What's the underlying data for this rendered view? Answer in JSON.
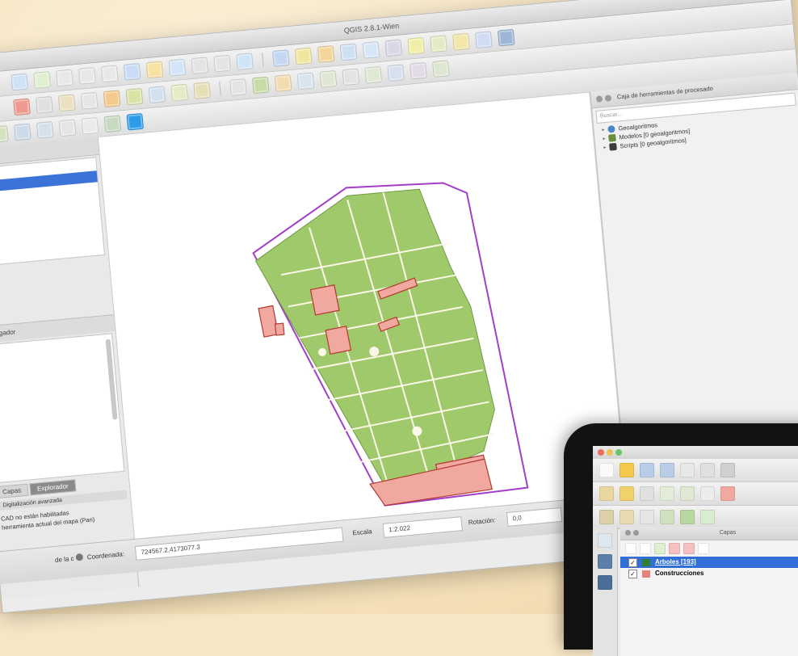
{
  "window": {
    "title": "QGIS 2.8.1-Wien"
  },
  "processing_toolbox": {
    "title": "Caja de herramientas de procesado",
    "search_placeholder": "Buscar...",
    "items": [
      {
        "label": "Geoalgoritmos",
        "icon": "gear-icon"
      },
      {
        "label": "Modelos [0 geoalgoritmos]",
        "icon": "model-icon"
      },
      {
        "label": "Scripts [0 geoalgoritmos]",
        "icon": "script-icon"
      }
    ]
  },
  "left_panel": {
    "browser_title": "Navegador",
    "tabs": [
      "Capas",
      "Explorador"
    ],
    "advanced_section": "Digitalización avanzada",
    "message_line1": "CAD no están habilitadas",
    "message_line2": "herramienta actual del mapa (Pan)"
  },
  "status": {
    "coord_toggle_label": "de la c",
    "coord_label": "Coordenada:",
    "coord_value": "724567.2,4173077.3",
    "scale_label": "Escala",
    "scale_value": "1:2.022",
    "rotation_label": "Rotación:",
    "rotation_value": "0,0"
  },
  "tablet": {
    "layers_title": "Capas",
    "layers": [
      {
        "label": "Arboles [193]",
        "selected": true,
        "color": "#2e7d32"
      },
      {
        "label": "Construcciones",
        "selected": false,
        "color": "#e8827a"
      }
    ]
  },
  "colors": {
    "parcel_fill": "#9fc96a",
    "building_fill": "#f0a8a0",
    "building_stroke": "#b23a2e",
    "boundary": "#a23ec8",
    "selection": "#3b73d8"
  }
}
